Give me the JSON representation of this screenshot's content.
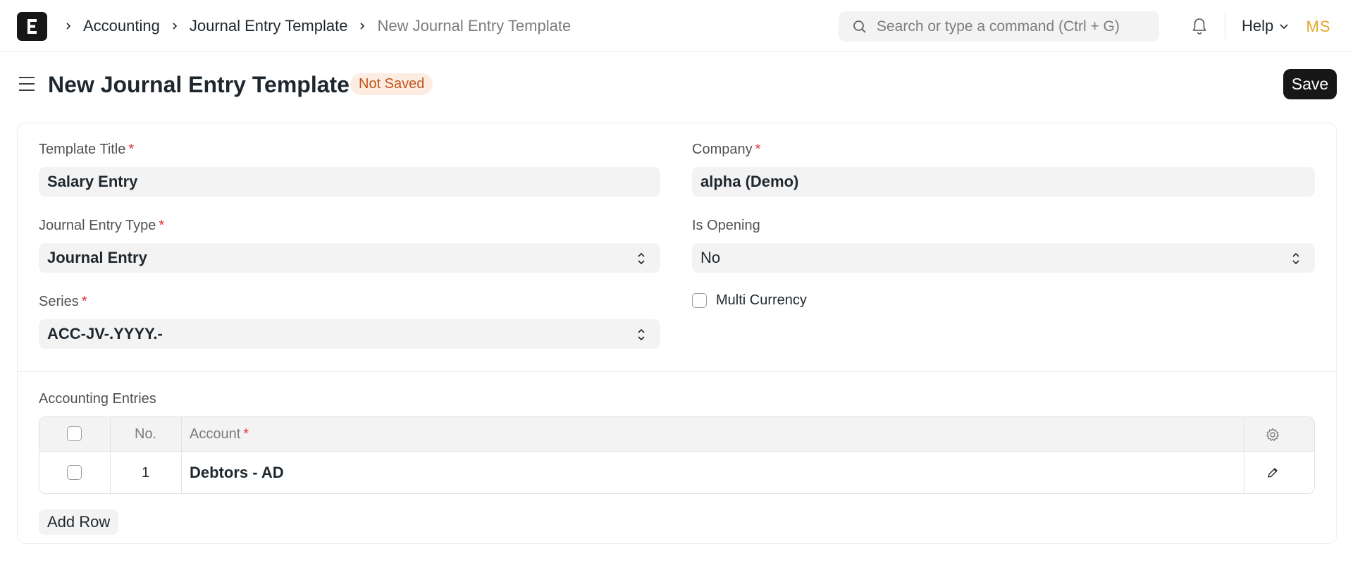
{
  "navbar": {
    "logo_letter": "E",
    "breadcrumbs": [
      {
        "label": "Accounting"
      },
      {
        "label": "Journal Entry Template"
      },
      {
        "label": "New Journal Entry Template"
      }
    ],
    "search_placeholder": "Search or type a command (Ctrl + G)",
    "help_label": "Help",
    "avatar_initials": "MS",
    "icons": {
      "search": "search-icon",
      "bell": "bell-icon",
      "chevron": "chevron-down-icon"
    }
  },
  "page": {
    "title": "New Journal Entry Template",
    "status_badge": "Not Saved",
    "save_label": "Save"
  },
  "form": {
    "template_title": {
      "label": "Template Title",
      "required": "*",
      "value": "Salary Entry"
    },
    "company": {
      "label": "Company",
      "required": "*",
      "value": "alpha (Demo)"
    },
    "journal_entry_type": {
      "label": "Journal Entry Type",
      "required": "*",
      "value": "Journal Entry"
    },
    "is_opening": {
      "label": "Is Opening",
      "value": "No"
    },
    "series": {
      "label": "Series",
      "required": "*",
      "value": "ACC-JV-.YYYY.-"
    },
    "multi_currency": {
      "label": "Multi Currency",
      "checked": false
    }
  },
  "accounting_entries": {
    "label": "Accounting Entries",
    "columns": {
      "no": "No.",
      "account": "Account",
      "account_required": "*"
    },
    "rows": [
      {
        "no": "1",
        "account": "Debtors - AD"
      }
    ],
    "add_row_label": "Add Row"
  },
  "colors": {
    "primary_dark": "#171717",
    "badge_bg": "#fdece2",
    "badge_text": "#c0551c",
    "required": "#e03636",
    "avatar": "#e2a52a"
  }
}
